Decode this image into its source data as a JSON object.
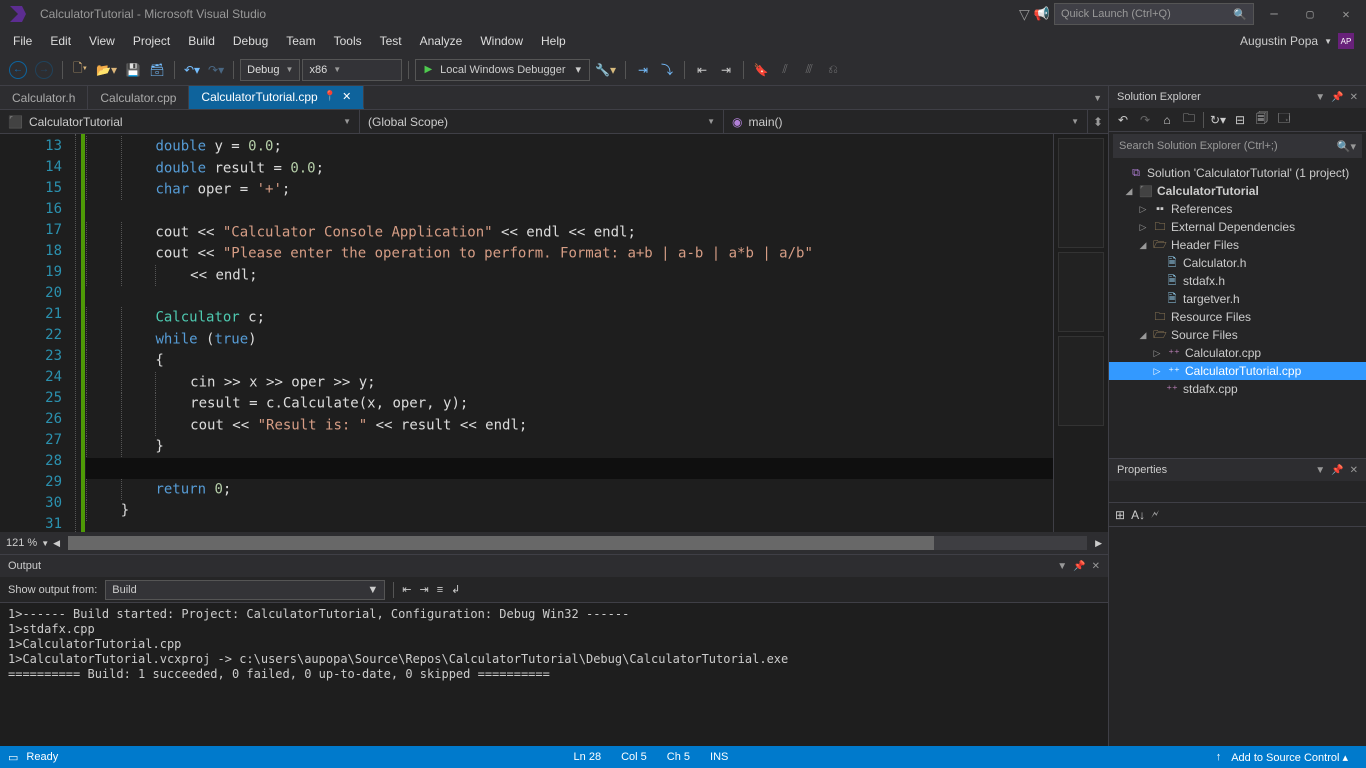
{
  "title": "CalculatorTutorial - Microsoft Visual Studio",
  "quickLaunch": {
    "placeholder": "Quick Launch (Ctrl+Q)"
  },
  "menus": [
    "File",
    "Edit",
    "View",
    "Project",
    "Build",
    "Debug",
    "Team",
    "Tools",
    "Test",
    "Analyze",
    "Window",
    "Help"
  ],
  "user": {
    "name": "Augustin Popa",
    "initials": "AP"
  },
  "toolbar": {
    "config": "Debug",
    "platform": "x86",
    "runTarget": "Local Windows Debugger"
  },
  "tabs": [
    {
      "label": "Calculator.h",
      "active": false
    },
    {
      "label": "Calculator.cpp",
      "active": false
    },
    {
      "label": "CalculatorTutorial.cpp",
      "active": true
    }
  ],
  "context": {
    "project": "CalculatorTutorial",
    "scope": "(Global Scope)",
    "func": "main()"
  },
  "gutter": {
    "start": 13,
    "end": 31
  },
  "code": [
    {
      "i": "        ",
      "t": [
        {
          "c": "kw",
          "s": "double"
        },
        {
          "s": " y = "
        },
        {
          "c": "num",
          "s": "0.0"
        },
        {
          "s": ";"
        }
      ]
    },
    {
      "i": "        ",
      "t": [
        {
          "c": "kw",
          "s": "double"
        },
        {
          "s": " result = "
        },
        {
          "c": "num",
          "s": "0.0"
        },
        {
          "s": ";"
        }
      ]
    },
    {
      "i": "        ",
      "t": [
        {
          "c": "kw",
          "s": "char"
        },
        {
          "s": " oper = "
        },
        {
          "c": "str",
          "s": "'+'"
        },
        {
          "s": ";"
        }
      ]
    },
    {
      "i": "",
      "t": []
    },
    {
      "i": "        ",
      "t": [
        {
          "s": "cout << "
        },
        {
          "c": "str",
          "s": "\"Calculator Console Application\""
        },
        {
          "s": " << endl << endl;"
        }
      ]
    },
    {
      "i": "        ",
      "t": [
        {
          "s": "cout << "
        },
        {
          "c": "str",
          "s": "\"Please enter the operation to perform. Format: a+b | a-b | a*b | a/b\""
        }
      ]
    },
    {
      "i": "            ",
      "t": [
        {
          "s": "<< endl;"
        }
      ]
    },
    {
      "i": "",
      "t": []
    },
    {
      "i": "        ",
      "t": [
        {
          "c": "type",
          "s": "Calculator"
        },
        {
          "s": " c;"
        }
      ]
    },
    {
      "i": "        ",
      "t": [
        {
          "c": "kw",
          "s": "while"
        },
        {
          "s": " ("
        },
        {
          "c": "kw",
          "s": "true"
        },
        {
          "s": ")"
        }
      ]
    },
    {
      "i": "        ",
      "t": [
        {
          "s": "{"
        }
      ]
    },
    {
      "i": "            ",
      "t": [
        {
          "s": "cin >> x >> oper >> y;"
        }
      ]
    },
    {
      "i": "            ",
      "t": [
        {
          "s": "result = c.Calculate(x, oper, y);"
        }
      ]
    },
    {
      "i": "            ",
      "t": [
        {
          "s": "cout << "
        },
        {
          "c": "str",
          "s": "\"Result is: \""
        },
        {
          "s": " << result << endl;"
        }
      ]
    },
    {
      "i": "        ",
      "t": [
        {
          "s": "}"
        }
      ]
    },
    {
      "i": "",
      "hl": true,
      "t": []
    },
    {
      "i": "        ",
      "t": [
        {
          "c": "kw",
          "s": "return"
        },
        {
          "s": " "
        },
        {
          "c": "num",
          "s": "0"
        },
        {
          "s": ";"
        }
      ]
    },
    {
      "i": "    ",
      "t": [
        {
          "s": "}"
        }
      ]
    },
    {
      "i": "",
      "t": []
    }
  ],
  "zoom": "121 %",
  "output": {
    "title": "Output",
    "fromLabel": "Show output from:",
    "source": "Build",
    "lines": [
      "1>------ Build started: Project: CalculatorTutorial, Configuration: Debug Win32 ------",
      "1>stdafx.cpp",
      "1>CalculatorTutorial.cpp",
      "1>CalculatorTutorial.vcxproj -> c:\\users\\aupopa\\Source\\Repos\\CalculatorTutorial\\Debug\\CalculatorTutorial.exe",
      "========== Build: 1 succeeded, 0 failed, 0 up-to-date, 0 skipped =========="
    ]
  },
  "solutionExplorer": {
    "title": "Solution Explorer",
    "searchPlaceholder": "Search Solution Explorer (Ctrl+;)",
    "solution": "Solution 'CalculatorTutorial' (1 project)",
    "project": "CalculatorTutorial",
    "nodes": {
      "references": "References",
      "externalDeps": "External Dependencies",
      "headerFiles": "Header Files",
      "headers": [
        "Calculator.h",
        "stdafx.h",
        "targetver.h"
      ],
      "resourceFiles": "Resource Files",
      "sourceFiles": "Source Files",
      "sources": [
        "Calculator.cpp",
        "CalculatorTutorial.cpp",
        "stdafx.cpp"
      ]
    }
  },
  "properties": {
    "title": "Properties"
  },
  "status": {
    "ready": "Ready",
    "ln": "Ln 28",
    "col": "Col 5",
    "ch": "Ch 5",
    "ins": "INS",
    "sourceControl": "Add to Source Control"
  }
}
